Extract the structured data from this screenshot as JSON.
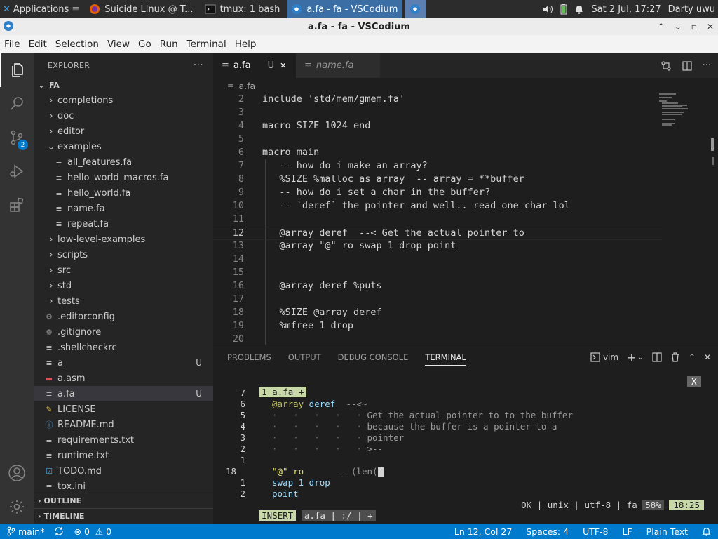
{
  "system_panel": {
    "apps_label": "Applications",
    "tasks": [
      {
        "label": "Suicide Linux @ T..."
      },
      {
        "label": "tmux: 1 bash"
      },
      {
        "label": "a.fa - fa - VSCodium"
      }
    ],
    "datetime": "Sat  2 Jul, 17:27",
    "user": "Darty uwu"
  },
  "window": {
    "title": "a.fa - fa - VSCodium"
  },
  "menubar": [
    "File",
    "Edit",
    "Selection",
    "View",
    "Go",
    "Run",
    "Terminal",
    "Help"
  ],
  "activity": {
    "scm_badge": "2"
  },
  "sidebar": {
    "title": "EXPLORER",
    "more": "···",
    "root": "FA",
    "items": [
      {
        "label": "completions",
        "type": "folder",
        "expanded": false,
        "status": ""
      },
      {
        "label": "doc",
        "type": "folder",
        "expanded": false,
        "status": ""
      },
      {
        "label": "editor",
        "type": "folder",
        "expanded": false,
        "status": ""
      },
      {
        "label": "examples",
        "type": "folder",
        "expanded": true,
        "status": ""
      },
      {
        "label": "all_features.fa",
        "type": "file",
        "status": ""
      },
      {
        "label": "hello_world_macros.fa",
        "type": "file",
        "status": ""
      },
      {
        "label": "hello_world.fa",
        "type": "file",
        "status": ""
      },
      {
        "label": "name.fa",
        "type": "file",
        "status": ""
      },
      {
        "label": "repeat.fa",
        "type": "file",
        "status": ""
      },
      {
        "label": "low-level-examples",
        "type": "folder",
        "expanded": false,
        "status": ""
      },
      {
        "label": "scripts",
        "type": "folder",
        "expanded": false,
        "status": ""
      },
      {
        "label": "src",
        "type": "folder",
        "expanded": false,
        "status": ""
      },
      {
        "label": "std",
        "type": "folder",
        "expanded": false,
        "status": ""
      },
      {
        "label": "tests",
        "type": "folder",
        "expanded": false,
        "status": ""
      },
      {
        "label": ".editorconfig",
        "type": "file",
        "status": ""
      },
      {
        "label": ".gitignore",
        "type": "file",
        "status": ""
      },
      {
        "label": ".shellcheckrc",
        "type": "file",
        "status": ""
      },
      {
        "label": "a",
        "type": "file",
        "status": "U"
      },
      {
        "label": "a.asm",
        "type": "file",
        "status": ""
      },
      {
        "label": "a.fa",
        "type": "file",
        "status": "U"
      },
      {
        "label": "LICENSE",
        "type": "file",
        "status": ""
      },
      {
        "label": "README.md",
        "type": "file",
        "status": ""
      },
      {
        "label": "requirements.txt",
        "type": "file",
        "status": ""
      },
      {
        "label": "runtime.txt",
        "type": "file",
        "status": ""
      },
      {
        "label": "TODO.md",
        "type": "file",
        "status": ""
      },
      {
        "label": "tox.ini",
        "type": "file",
        "status": ""
      }
    ],
    "outline": "OUTLINE",
    "timeline": "TIMELINE"
  },
  "editor": {
    "tabs": [
      {
        "label": "a.fa",
        "status": "U",
        "close": "✕"
      },
      {
        "label": "name.fa"
      }
    ],
    "breadcrumb": "a.fa",
    "lines": [
      {
        "n": "2",
        "text": "include 'std/mem/gmem.fa'"
      },
      {
        "n": "3",
        "text": ""
      },
      {
        "n": "4",
        "text": "macro SIZE 1024 end"
      },
      {
        "n": "5",
        "text": ""
      },
      {
        "n": "6",
        "text": "macro main"
      },
      {
        "n": "7",
        "text": "   -- how do i make an array?"
      },
      {
        "n": "8",
        "text": "   %SIZE %malloc as array  -- array = **buffer"
      },
      {
        "n": "9",
        "text": "   -- how do i set a char in the buffer?"
      },
      {
        "n": "10",
        "text": "   -- `deref` the pointer and well.. read one char lol"
      },
      {
        "n": "11",
        "text": ""
      },
      {
        "n": "12",
        "text": "   @array deref  --< Get the actual pointer to"
      },
      {
        "n": "13",
        "text": "   @array \"@\" ro swap 1 drop point"
      },
      {
        "n": "14",
        "text": ""
      },
      {
        "n": "15",
        "text": ""
      },
      {
        "n": "16",
        "text": "   @array deref %puts"
      },
      {
        "n": "17",
        "text": ""
      },
      {
        "n": "18",
        "text": "   %SIZE @array deref"
      },
      {
        "n": "19",
        "text": "   %mfree 1 drop"
      },
      {
        "n": "20",
        "text": ""
      }
    ]
  },
  "panel": {
    "tabs": [
      "PROBLEMS",
      "OUTPUT",
      "DEBUG CONSOLE",
      "TERMINAL"
    ],
    "terminal_name": "vim",
    "vim": {
      "tab": "1 a.fa +",
      "close": "X",
      "lines": [
        {
          "n": "7",
          "var": "",
          "cmd": "",
          "text": ""
        },
        {
          "n": "6",
          "var": "@array",
          "cmd": " deref",
          "text": "  --<~"
        },
        {
          "n": "5",
          "dots": "·   ·   ·   ·   · ",
          "text": "Get the actual pointer to to the buffer"
        },
        {
          "n": "4",
          "dots": "·   ·   ·   ·   · ",
          "text": "because the buffer is a pointer to a"
        },
        {
          "n": "3",
          "dots": "·   ·   ·   ·   · ",
          "text": "pointer"
        },
        {
          "n": "2",
          "dots": "·   ·   ·   ·   · ",
          "text": ">--"
        },
        {
          "n": "1",
          "var": "",
          "cmd": "",
          "text": ""
        },
        {
          "n": "18",
          "cur": true,
          "str": "\"@\" ro",
          "text": "      -- (len("
        },
        {
          "n": "1",
          "plain": "swap 1 drop"
        },
        {
          "n": "2",
          "plain": "point"
        }
      ],
      "mode": "INSERT",
      "file": "a.fa | :/ | +",
      "right_info": "OK | unix | utf-8 | fa ",
      "percent": "58%",
      "position": "18:25"
    }
  },
  "statusbar": {
    "branch": "main*",
    "errors": "0",
    "warnings": "0",
    "position": "Ln 12, Col 27",
    "spaces": "Spaces: 4",
    "encoding": "UTF-8",
    "eol": "LF",
    "language": "Plain Text"
  }
}
